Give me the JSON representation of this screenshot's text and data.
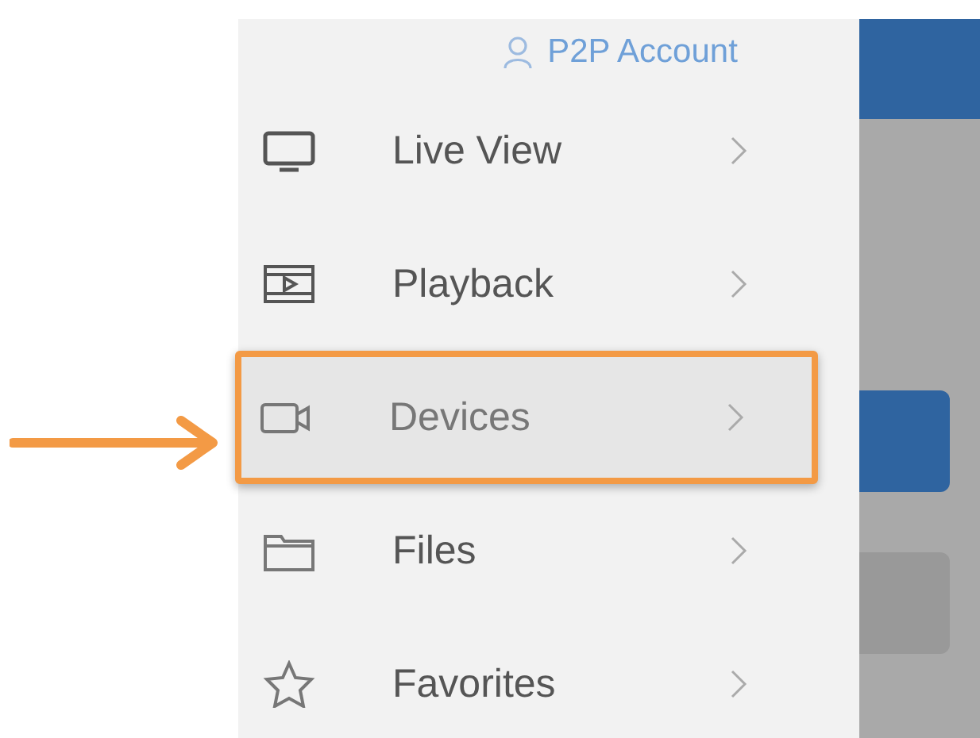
{
  "account": {
    "label": "P2P Account"
  },
  "menu": [
    {
      "kind": "monitor",
      "label": "Live View",
      "selected": false,
      "highlighted": false
    },
    {
      "kind": "film",
      "label": "Playback",
      "selected": false,
      "highlighted": false
    },
    {
      "kind": "camera",
      "label": "Devices",
      "selected": true,
      "highlighted": true
    },
    {
      "kind": "folder",
      "label": "Files",
      "selected": false,
      "highlighted": false
    },
    {
      "kind": "star",
      "label": "Favorites",
      "selected": false,
      "highlighted": false
    }
  ]
}
